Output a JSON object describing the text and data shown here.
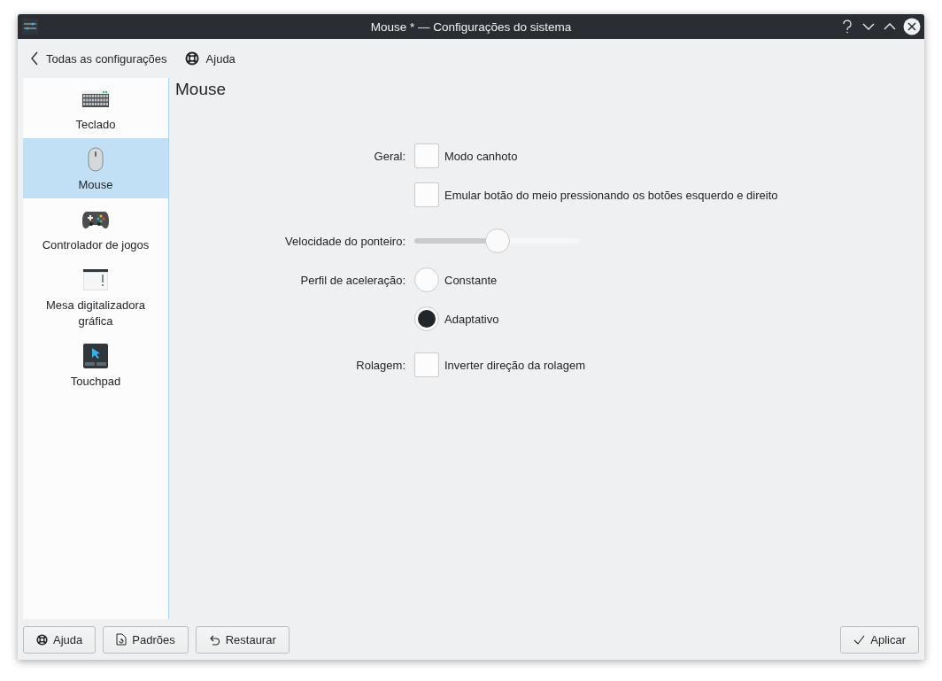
{
  "window": {
    "title": "Mouse * — Configurações do sistema"
  },
  "toolbar": {
    "back": "Todas as configurações",
    "help": "Ajuda"
  },
  "sidebar": {
    "items": [
      {
        "label": "Teclado",
        "kind": "keyboard",
        "selected": false
      },
      {
        "label": "Mouse",
        "kind": "mouse",
        "selected": true
      },
      {
        "label": "Controlador de jogos",
        "kind": "gamepad",
        "selected": false
      },
      {
        "label": "Mesa digitalizadora gráfica",
        "kind": "tablet",
        "selected": false
      },
      {
        "label": "Touchpad",
        "kind": "touchpad",
        "selected": false
      }
    ]
  },
  "page": {
    "title": "Mouse",
    "rows": [
      {
        "kind": "checkbox",
        "label": "Geral:",
        "text": "Modo canhoto",
        "checked": false
      },
      {
        "kind": "checkbox",
        "text": "Emular botão do meio pressionando os botões esquerdo e direito",
        "checked": false
      },
      {
        "kind": "slider",
        "label": "Velocidade do ponteiro:",
        "level": 0.5
      },
      {
        "kind": "radio",
        "label": "Perfil de aceleração:",
        "text": "Constante",
        "selected": false
      },
      {
        "kind": "radio",
        "text": "Adaptativo",
        "selected": true
      },
      {
        "kind": "checkbox",
        "label": "Rolagem:",
        "text": "Inverter direção da rolagem",
        "checked": false
      }
    ]
  },
  "buttons": [
    {
      "label": "Ajuda",
      "kind": "help"
    },
    {
      "label": "Padrões",
      "kind": "defaults"
    },
    {
      "label": "Restaurar",
      "kind": "reset"
    }
  ],
  "apply_button": {
    "label": "Aplicar"
  }
}
